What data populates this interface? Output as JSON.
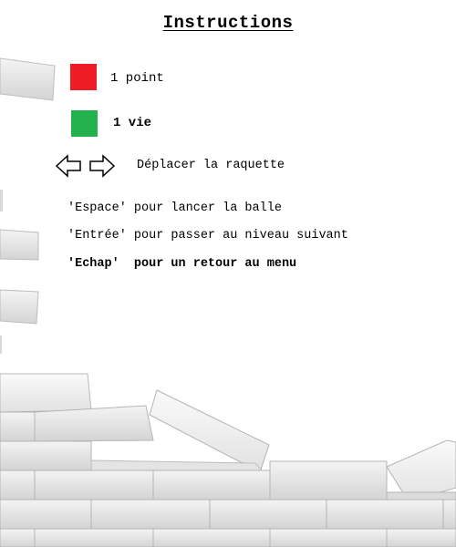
{
  "screen": {
    "title": "Instructions"
  },
  "legend": [
    {
      "icon": "red-square",
      "color": "#ee1c24",
      "label": "1 point"
    },
    {
      "icon": "green-square",
      "color": "#22b14c",
      "label": "1 vie"
    }
  ],
  "controls": {
    "arrows_icon": "left-right-arrows",
    "label": "Déplacer la raquette"
  },
  "instructions": [
    "'Espace' pour lancer la balle",
    "'Entrée' pour passer au niveau suivant",
    "'Echap'  pour un retour au menu"
  ]
}
